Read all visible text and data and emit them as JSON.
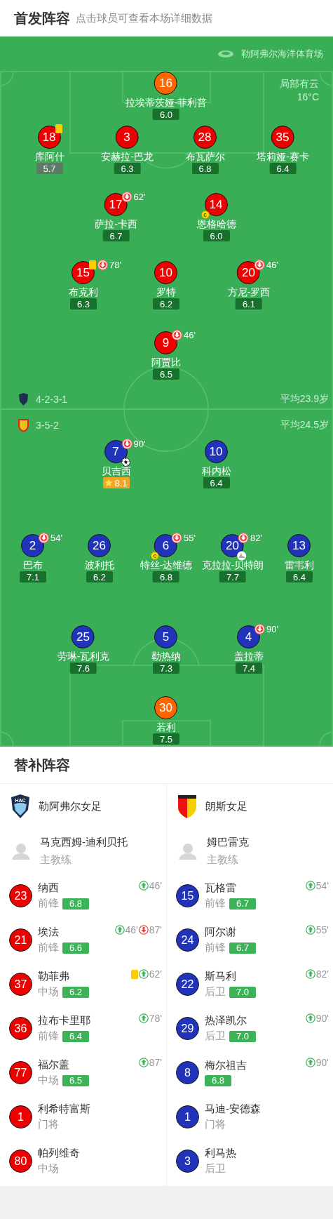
{
  "header": {
    "title": "首发阵容",
    "subtitle": "点击球员可查看本场详细数据"
  },
  "stadium": "勒阿弗尔海洋体育场",
  "weather": {
    "condition": "局部有云",
    "temperature": "16°C"
  },
  "home": {
    "formation": "4-2-3-1",
    "avg_age": "平均23.9岁",
    "lines": [
      {
        "players": [
          {
            "number": "16",
            "name": "拉埃蒂茨娅-菲利普",
            "rating": "6.0",
            "mvp": false,
            "color": "#ff6600"
          }
        ]
      },
      {
        "players": [
          {
            "number": "18",
            "name": "库阿什",
            "rating": "5.7",
            "mvp": false,
            "color": "#ee0000",
            "events": [
              {
                "kind": "yellow_card"
              }
            ]
          },
          {
            "number": "3",
            "name": "安赫拉-巴龙",
            "rating": "6.3",
            "mvp": false,
            "color": "#ee0000"
          },
          {
            "number": "28",
            "name": "布瓦萨尔",
            "rating": "6.8",
            "mvp": false,
            "color": "#ee0000"
          },
          {
            "number": "35",
            "name": "塔莉娅-赛卡",
            "rating": "6.4",
            "mvp": false,
            "color": "#ee0000"
          }
        ]
      },
      {
        "players": [
          {
            "number": "17",
            "name": "萨拉-卡西",
            "rating": "6.7",
            "mvp": false,
            "color": "#ee0000",
            "events": [
              {
                "kind": "sub_out",
                "minute": "62'"
              }
            ]
          },
          {
            "number": "14",
            "name": "恩格哈德",
            "rating": "6.0",
            "mvp": false,
            "color": "#ee0000",
            "events": [
              {
                "kind": "captain",
                "label": "c"
              }
            ]
          }
        ]
      },
      {
        "players": [
          {
            "number": "15",
            "name": "布克利",
            "rating": "6.3",
            "mvp": false,
            "color": "#ee0000",
            "events": [
              {
                "kind": "yellow_card"
              },
              {
                "kind": "sub_out",
                "minute": "78'"
              }
            ]
          },
          {
            "number": "10",
            "name": "罗特",
            "rating": "6.2",
            "mvp": false,
            "color": "#ee0000"
          },
          {
            "number": "20",
            "name": "方尼-罗西",
            "rating": "6.1",
            "mvp": false,
            "color": "#ee0000",
            "events": [
              {
                "kind": "sub_out",
                "minute": "46'"
              }
            ]
          }
        ]
      },
      {
        "players": [
          {
            "number": "9",
            "name": "阿贾比",
            "rating": "6.5",
            "mvp": false,
            "color": "#ee0000",
            "events": [
              {
                "kind": "sub_out",
                "minute": "46'"
              }
            ]
          }
        ]
      }
    ]
  },
  "away": {
    "formation": "3-5-2",
    "avg_age": "平均24.5岁",
    "lines": [
      {
        "players": [
          {
            "number": "7",
            "name": "贝吉西",
            "rating": "8.1",
            "mvp": true,
            "color": "#2233bb",
            "events": [
              {
                "kind": "sub_out",
                "minute": "90'"
              },
              {
                "kind": "goal"
              }
            ]
          },
          {
            "number": "10",
            "name": "科内松",
            "rating": "6.4",
            "mvp": false,
            "color": "#2233bb"
          }
        ]
      },
      {
        "players": [
          {
            "number": "2",
            "name": "巴布",
            "rating": "7.1",
            "mvp": false,
            "color": "#2233bb",
            "events": [
              {
                "kind": "sub_out",
                "minute": "54'"
              }
            ]
          },
          {
            "number": "26",
            "name": "波利托",
            "rating": "6.2",
            "mvp": false,
            "color": "#2233bb"
          },
          {
            "number": "6",
            "name": "特丝-达维德",
            "rating": "6.8",
            "mvp": false,
            "color": "#2233bb",
            "events": [
              {
                "kind": "sub_out",
                "minute": "55'"
              },
              {
                "kind": "captain",
                "label": "c"
              }
            ]
          },
          {
            "number": "20",
            "name": "克拉拉-贝特朗",
            "rating": "7.7",
            "mvp": false,
            "color": "#2233bb",
            "events": [
              {
                "kind": "sub_out",
                "minute": "82'"
              },
              {
                "kind": "assist"
              }
            ]
          },
          {
            "number": "13",
            "name": "雷韦利",
            "rating": "6.4",
            "mvp": false,
            "color": "#2233bb"
          }
        ]
      },
      {
        "players": [
          {
            "number": "25",
            "name": "劳琳-瓦利克",
            "rating": "7.6",
            "mvp": false,
            "color": "#2233bb"
          },
          {
            "number": "5",
            "name": "勒热纳",
            "rating": "7.3",
            "mvp": false,
            "color": "#2233bb"
          },
          {
            "number": "4",
            "name": "盖拉蒂",
            "rating": "7.4",
            "mvp": false,
            "color": "#2233bb",
            "events": [
              {
                "kind": "sub_out",
                "minute": "90'"
              }
            ]
          }
        ]
      },
      {
        "players": [
          {
            "number": "30",
            "name": "若利",
            "rating": "7.5",
            "mvp": false,
            "color": "#ff6600"
          }
        ]
      }
    ]
  },
  "subs": {
    "title": "替补阵容",
    "teams": [
      {
        "name": "勒阿弗尔女足",
        "logo_text": "HAC",
        "coach": {
          "name": "马克西姆-迪利贝托",
          "role": "主教练"
        },
        "players": [
          {
            "number": "23",
            "name": "纳西",
            "position": "前锋",
            "rating": "6.8",
            "color": "#ee0000",
            "events": [
              {
                "kind": "sub_in",
                "minute": "46'"
              }
            ]
          },
          {
            "number": "21",
            "name": "埃法",
            "position": "前锋",
            "rating": "6.6",
            "color": "#ee0000",
            "events": [
              {
                "kind": "sub_in",
                "minute": "46'"
              },
              {
                "kind": "sub_out",
                "minute": "87'"
              }
            ]
          },
          {
            "number": "37",
            "name": "勒菲弗",
            "position": "中场",
            "rating": "6.2",
            "color": "#ee0000",
            "events": [
              {
                "kind": "yellow_card"
              },
              {
                "kind": "sub_in",
                "minute": "62'"
              }
            ]
          },
          {
            "number": "36",
            "name": "拉布卡里耶",
            "position": "前锋",
            "rating": "6.4",
            "color": "#ee0000",
            "events": [
              {
                "kind": "sub_in",
                "minute": "78'"
              }
            ]
          },
          {
            "number": "77",
            "name": "福尔盖",
            "position": "中场",
            "rating": "6.5",
            "color": "#ee0000",
            "events": [
              {
                "kind": "sub_in",
                "minute": "87'"
              }
            ]
          },
          {
            "number": "1",
            "name": "利希特富斯",
            "position": "门将",
            "color": "#ee0000"
          },
          {
            "number": "80",
            "name": "帕列维奇",
            "position": "中场",
            "color": "#ee0000"
          }
        ]
      },
      {
        "name": "朗斯女足",
        "coach": {
          "name": "姆巴雷克",
          "role": "主教练"
        },
        "players": [
          {
            "number": "15",
            "name": "瓦格雷",
            "position": "前锋",
            "rating": "6.7",
            "color": "#2233bb",
            "events": [
              {
                "kind": "sub_in",
                "minute": "54'"
              }
            ]
          },
          {
            "number": "24",
            "name": "阿尔谢",
            "position": "前锋",
            "rating": "6.7",
            "color": "#2233bb",
            "events": [
              {
                "kind": "sub_in",
                "minute": "55'"
              }
            ]
          },
          {
            "number": "22",
            "name": "斯马利",
            "position": "后卫",
            "rating": "7.0",
            "color": "#2233bb",
            "events": [
              {
                "kind": "sub_in",
                "minute": "82'"
              }
            ]
          },
          {
            "number": "29",
            "name": "热泽凯尔",
            "position": "后卫",
            "rating": "7.0",
            "color": "#2233bb",
            "events": [
              {
                "kind": "sub_in",
                "minute": "90'"
              }
            ]
          },
          {
            "number": "8",
            "name": "梅尔祖吉",
            "rating": "6.8",
            "color": "#2233bb",
            "events": [
              {
                "kind": "sub_in",
                "minute": "90'"
              }
            ]
          },
          {
            "number": "1",
            "name": "马迪-安德森",
            "position": "门将",
            "color": "#2233bb"
          },
          {
            "number": "3",
            "name": "利马热",
            "position": "后卫",
            "color": "#2233bb"
          }
        ]
      }
    ]
  }
}
